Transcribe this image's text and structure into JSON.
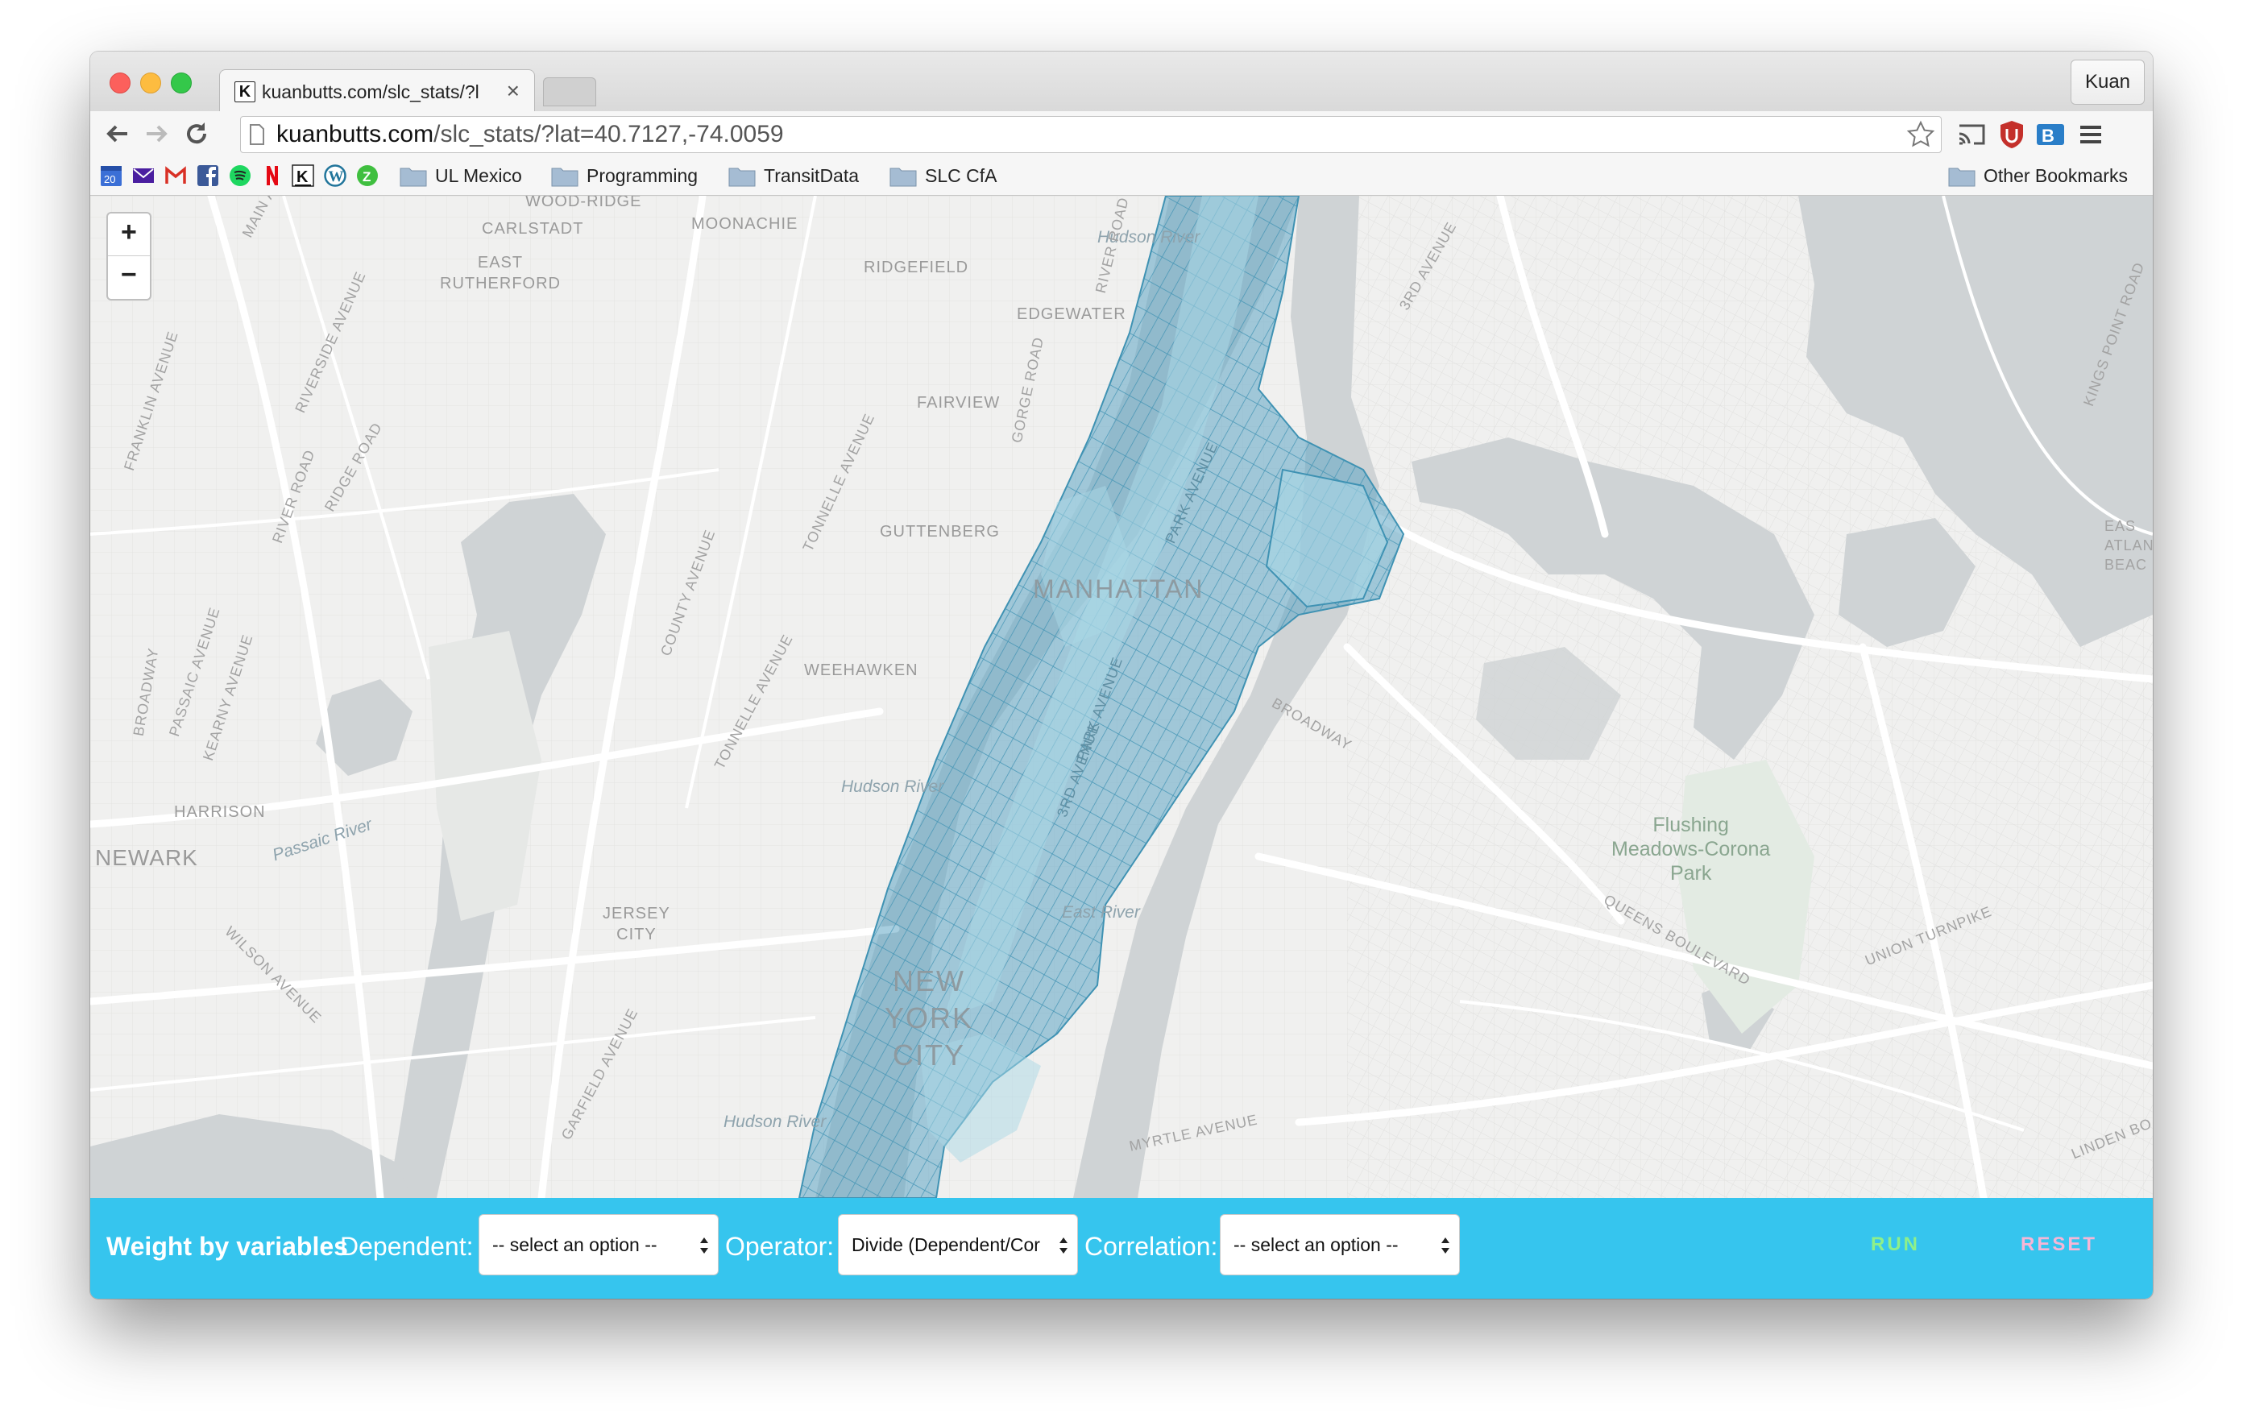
{
  "browser": {
    "tab_title": "kuanbutts.com/slc_stats/?l",
    "tab_favicon": "K",
    "profile_name": "Kuan",
    "url_host": "kuanbutts.com",
    "url_path": "/slc_stats/?lat=40.7127,-74.0059"
  },
  "bookmarks": {
    "icons": [
      "calendar-icon",
      "yahoo-mail-icon",
      "gmail-icon",
      "facebook-icon",
      "spotify-icon",
      "netflix-icon",
      "kuanbutts-icon",
      "wordpress-icon",
      "zillow-icon"
    ],
    "calendar_day": "20",
    "folders": [
      "UL Mexico",
      "Programming",
      "TransitData",
      "SLC CfA"
    ],
    "other": "Other Bookmarks"
  },
  "map": {
    "zoom_in": "+",
    "zoom_out": "−",
    "labels": {
      "wood_ridge": "WOOD-RIDGE",
      "carlstadt": "CARLSTADT",
      "moonachie": "MOONACHIE",
      "ridgefield": "RIDGEFIELD",
      "east_rutherford": "EAST\nRUTHERFORD",
      "edgewater": "EDGEWATER",
      "fairview": "FAIRVIEW",
      "guttenberg": "GUTTENBERG",
      "weehawken": "WEEHAWKEN",
      "harrison": "HARRISON",
      "newark": "NEWARK",
      "jersey_city": "JERSEY\nCITY",
      "manhattan": "MANHATTAN",
      "new_york_city": "NEW\nYORK\nCITY",
      "hudson_river_1": "Hudson River",
      "hudson_river_2": "Hudson River",
      "hudson_river_3": "Hudson River",
      "east_river": "East River",
      "passaic_river": "Passaic River",
      "flushing": "Flushing\nMeadows-Corona\nPark",
      "main_avenue": "MAIN AVENUE",
      "franklin_avenue": "FRANKLIN AVENUE",
      "riverside_avenue": "RIVERSIDE AVENUE",
      "river_road": "RIVER ROAD",
      "ridge_road": "RIDGE ROAD",
      "passaic_avenue": "PASSAIC AVENUE",
      "broadway_1": "BROADWAY",
      "kearny_avenue": "KEARNY AVENUE",
      "county_avenue": "COUNTY AVENUE",
      "tonnelle_avenue_1": "TONNELLE AVENUE",
      "tonnelle_avenue_2": "TONNELLE AVENUE",
      "wilson_avenue": "WILSON AVENUE",
      "garfield_avenue": "GARFIELD AVENUE",
      "river_road_2": "RIVER ROAD",
      "gorge_road": "GORGE ROAD",
      "third_avenue": "3RD AVENUE",
      "broadway_2": "BROADWAY",
      "queens_boulevard": "QUEENS BOULEVARD",
      "union_turnpike": "UNION TURNPIKE",
      "myrtle_avenue": "MYRTLE AVENUE",
      "linden_blvd": "LINDEN BO",
      "kings_point_road": "KINGS POINT ROAD",
      "east_atlantic": "EAS\nATLAN\nBEAC",
      "park_avenue": "PARK AVENUE",
      "third_ave_2": "3RD AVENUE",
      "park_ave_2": "PARK AVENUE"
    }
  },
  "controls": {
    "title": "Weight by variables",
    "dependent_label": "Dependent:",
    "dependent_value": "-- select an option --",
    "operator_label": "Operator:",
    "operator_value": "Divide (Dependent/Cor",
    "correlation_label": "Correlation:",
    "correlation_value": "-- select an option --",
    "run": "RUN",
    "reset": "RESET",
    "run_color": "#8ef08a",
    "reset_color": "#f7b6d6",
    "bar_color": "#36c5ee"
  }
}
